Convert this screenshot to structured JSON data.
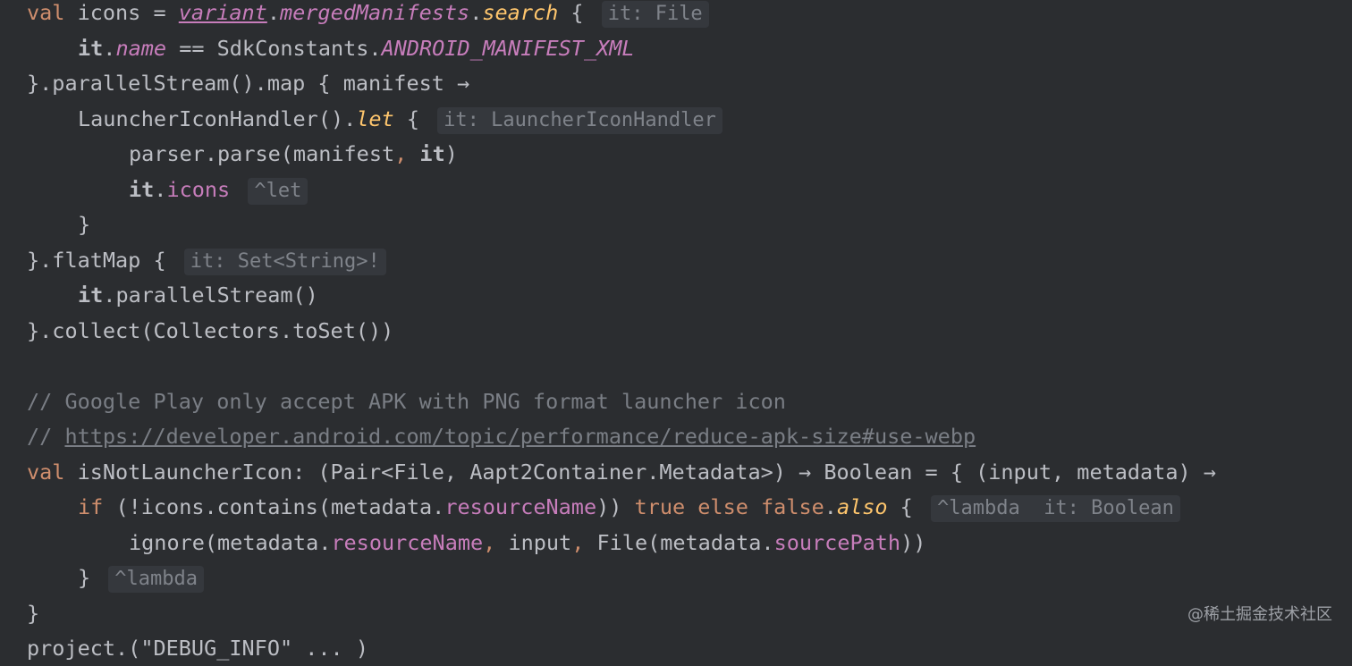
{
  "lines": [
    {
      "indent": 0,
      "tokens": [
        {
          "t": "val ",
          "c": "k"
        },
        {
          "t": "icons = ",
          "c": "pl"
        },
        {
          "t": "variant",
          "c": "st u"
        },
        {
          "t": ".",
          "c": "pl"
        },
        {
          "t": "mergedManifests",
          "c": "st"
        },
        {
          "t": ".",
          "c": "pl"
        },
        {
          "t": "search",
          "c": "ext"
        },
        {
          "t": " { ",
          "c": "pl"
        }
      ],
      "hint": "it: File"
    },
    {
      "indent": 1,
      "tokens": [
        {
          "t": "it",
          "c": "it"
        },
        {
          "t": ".",
          "c": "pl"
        },
        {
          "t": "name",
          "c": "st"
        },
        {
          "t": " == SdkConstants.",
          "c": "pl"
        },
        {
          "t": "ANDROID_MANIFEST_XML",
          "c": "st"
        }
      ]
    },
    {
      "indent": 0,
      "tokens": [
        {
          "t": "}.parallelStream().map { manifest →",
          "c": "pl"
        }
      ]
    },
    {
      "indent": 1,
      "tokens": [
        {
          "t": "LauncherIconHandler().",
          "c": "pl"
        },
        {
          "t": "let",
          "c": "ext"
        },
        {
          "t": " { ",
          "c": "pl"
        }
      ],
      "hint": "it: LauncherIconHandler"
    },
    {
      "indent": 2,
      "tokens": [
        {
          "t": "parser.parse(manifest",
          "c": "pl"
        },
        {
          "t": ", ",
          "c": "k"
        },
        {
          "t": "it",
          "c": "it"
        },
        {
          "t": ")",
          "c": "pl"
        }
      ]
    },
    {
      "indent": 2,
      "tokens": [
        {
          "t": "it",
          "c": "it"
        },
        {
          "t": ".",
          "c": "pl"
        },
        {
          "t": "icons",
          "c": "pr"
        },
        {
          "t": " ",
          "c": "pl"
        }
      ],
      "hint": "^let"
    },
    {
      "indent": 1,
      "tokens": [
        {
          "t": "}",
          "c": "pl"
        }
      ]
    },
    {
      "indent": 0,
      "tokens": [
        {
          "t": "}.flatMap { ",
          "c": "pl"
        }
      ],
      "hint": "it: Set<String>!"
    },
    {
      "indent": 1,
      "tokens": [
        {
          "t": "it",
          "c": "it"
        },
        {
          "t": ".parallelStream()",
          "c": "pl"
        }
      ]
    },
    {
      "indent": 0,
      "tokens": [
        {
          "t": "}.collect(Collectors.toSet())",
          "c": "pl"
        }
      ]
    },
    {
      "indent": 0,
      "tokens": []
    },
    {
      "indent": 0,
      "tokens": [
        {
          "t": "// Google Play only accept APK with PNG format launcher icon",
          "c": "cm"
        }
      ]
    },
    {
      "indent": 0,
      "tokens": [
        {
          "t": "// ",
          "c": "cm"
        },
        {
          "t": "https://developer.android.com/topic/performance/reduce-apk-size#use-webp",
          "c": "cm u"
        }
      ]
    },
    {
      "indent": 0,
      "tokens": [
        {
          "t": "val ",
          "c": "k"
        },
        {
          "t": "isNotLauncherIcon: (Pair<File, Aapt2Container.Metadata>) → Boolean = { (input, metadata) →",
          "c": "pl"
        }
      ]
    },
    {
      "indent": 1,
      "tokens": [
        {
          "t": "if ",
          "c": "k"
        },
        {
          "t": "(!icons.contains(metadata.",
          "c": "pl"
        },
        {
          "t": "resourceName",
          "c": "pr"
        },
        {
          "t": ")) ",
          "c": "pl"
        },
        {
          "t": "true else false",
          "c": "k"
        },
        {
          "t": ".",
          "c": "pl"
        },
        {
          "t": "also",
          "c": "ext"
        },
        {
          "t": " { ",
          "c": "pl"
        }
      ],
      "hint": "^lambda  it: Boolean"
    },
    {
      "indent": 2,
      "tokens": [
        {
          "t": "ignore(metadata.",
          "c": "pl"
        },
        {
          "t": "resourceName",
          "c": "pr"
        },
        {
          "t": ", ",
          "c": "k"
        },
        {
          "t": "input",
          "c": "pl"
        },
        {
          "t": ", ",
          "c": "k"
        },
        {
          "t": "File(metadata.",
          "c": "pl"
        },
        {
          "t": "sourcePath",
          "c": "pr"
        },
        {
          "t": "))",
          "c": "pl"
        }
      ]
    },
    {
      "indent": 1,
      "tokens": [
        {
          "t": "} ",
          "c": "pl"
        }
      ],
      "hint": "^lambda"
    },
    {
      "indent": 0,
      "tokens": [
        {
          "t": "}",
          "c": "pl"
        }
      ]
    },
    {
      "indent": 0,
      "tokens": [
        {
          "t": "project.(\"DEBUG_INFO\" ... )",
          "c": "pl"
        }
      ]
    }
  ],
  "watermark": "@稀土掘金技术社区"
}
